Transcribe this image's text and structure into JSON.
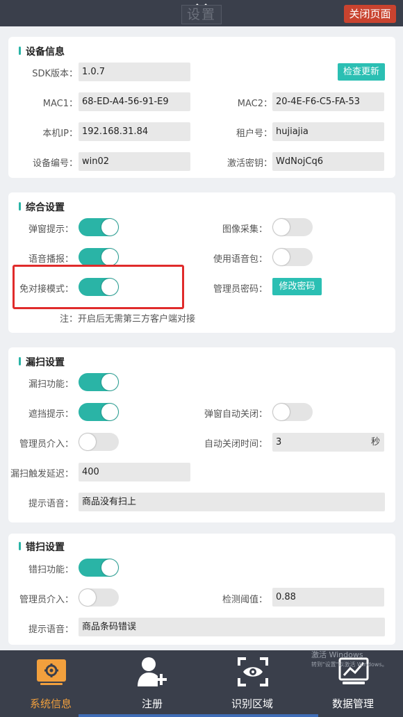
{
  "header": {
    "title": "设置",
    "close_label": "关闭页面"
  },
  "device_info": {
    "title": "设备信息",
    "sdk_label": "SDK版本：",
    "sdk_value": "1.0.7",
    "check_update_label": "检查更新",
    "mac1_label": "MAC1：",
    "mac1_value": "68-ED-A4-56-91-E9",
    "mac2_label": "MAC2：",
    "mac2_value": "20-4E-F6-C5-FA-53",
    "ip_label": "本机IP：",
    "ip_value": "192.168.31.84",
    "tenant_label": "租户号：",
    "tenant_value": "hujiajia",
    "device_no_label": "设备编号：",
    "device_no_value": "win02",
    "activation_label": "激活密钥：",
    "activation_value": "WdNojCq6"
  },
  "general": {
    "title": "综合设置",
    "popup_label": "弹窗提示：",
    "popup_on": true,
    "image_label": "图像采集：",
    "image_on": false,
    "voice_label": "语音播报：",
    "voice_on": true,
    "voicepack_label": "使用语音包：",
    "voicepack_on": false,
    "nodock_label": "免对接模式：",
    "nodock_on": true,
    "admin_pwd_label": "管理员密码：",
    "change_pwd_label": "修改密码",
    "note": "注：开启后无需第三方客户端对接"
  },
  "missed_scan": {
    "title": "漏扫设置",
    "func_label": "漏扫功能：",
    "func_on": true,
    "block_label": "遮挡提示：",
    "block_on": true,
    "autoclose_label": "弹窗自动关闭：",
    "autoclose_on": false,
    "admin_label": "管理员介入：",
    "admin_on": false,
    "autoclose_time_label": "自动关闭时间：",
    "autoclose_time_value": "3",
    "autoclose_time_unit": "秒",
    "delay_label": "漏扫触发延迟：",
    "delay_value": "400",
    "voice_label": "提示语音：",
    "voice_value": "商品没有扫上"
  },
  "wrong_scan": {
    "title": "错扫设置",
    "func_label": "错扫功能：",
    "func_on": true,
    "admin_label": "管理员介入：",
    "admin_on": false,
    "threshold_label": "检测阈值：",
    "threshold_value": "0.88",
    "voice_label": "提示语音：",
    "voice_value": "商品条码错误"
  },
  "nav": {
    "items": [
      {
        "label": "系统信息",
        "icon": "settings-monitor-icon",
        "active": true
      },
      {
        "label": "注册",
        "icon": "add-user-icon",
        "active": false
      },
      {
        "label": "识别区域",
        "icon": "scan-eye-icon",
        "active": false
      },
      {
        "label": "数据管理",
        "icon": "chart-monitor-icon",
        "active": false
      }
    ]
  },
  "watermark": {
    "line1": "激活 Windows",
    "line2": "转到\"设置\"以激活 Windows。"
  },
  "colors": {
    "accent": "#2ab4a6",
    "danger": "#c9432f",
    "active_nav": "#f2a03d",
    "highlight": "#e02b2b"
  }
}
